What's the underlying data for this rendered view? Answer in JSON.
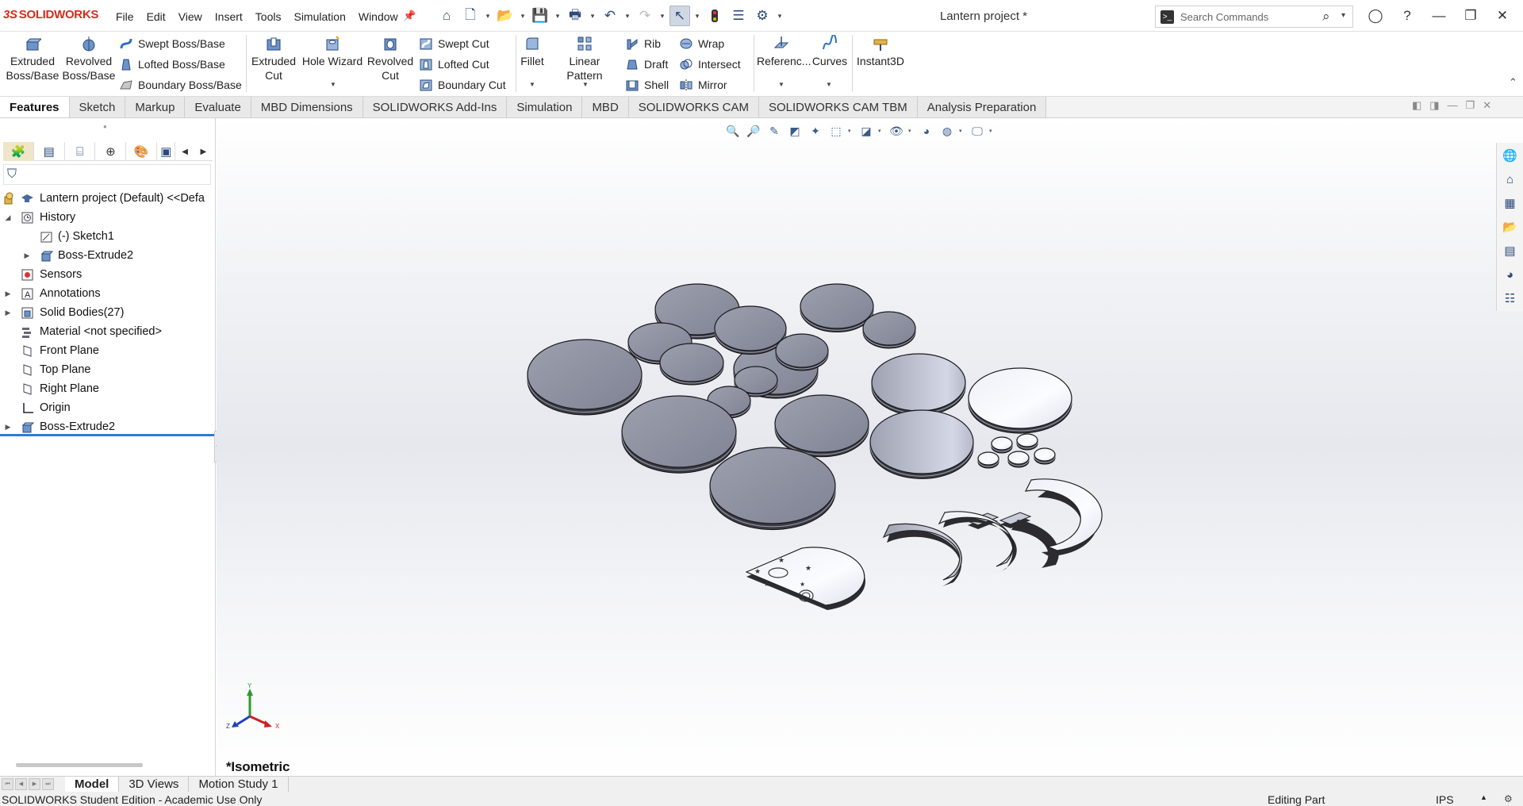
{
  "app": {
    "logo_prefix": "3S",
    "logo_text": "SOLIDWORKS",
    "document_title": "Lantern project *"
  },
  "menus": [
    "File",
    "Edit",
    "View",
    "Insert",
    "Tools",
    "Simulation",
    "Window"
  ],
  "search": {
    "placeholder": "Search Commands"
  },
  "ribbon": {
    "extruded_boss": "Extruded\nBoss/Base",
    "revolved_boss": "Revolved\nBoss/Base",
    "swept_boss": "Swept Boss/Base",
    "lofted_boss": "Lofted Boss/Base",
    "boundary_boss": "Boundary Boss/Base",
    "extruded_cut": "Extruded\nCut",
    "hole_wizard": "Hole Wizard",
    "revolved_cut": "Revolved\nCut",
    "swept_cut": "Swept Cut",
    "lofted_cut": "Lofted Cut",
    "boundary_cut": "Boundary Cut",
    "fillet": "Fillet",
    "linear_pattern": "Linear Pattern",
    "rib": "Rib",
    "draft": "Draft",
    "shell": "Shell",
    "wrap": "Wrap",
    "intersect": "Intersect",
    "mirror": "Mirror",
    "reference": "Referenc...",
    "curves": "Curves",
    "instant3d": "Instant3D"
  },
  "cm_tabs": [
    "Features",
    "Sketch",
    "Markup",
    "Evaluate",
    "MBD Dimensions",
    "SOLIDWORKS Add-Ins",
    "Simulation",
    "MBD",
    "SOLIDWORKS CAM",
    "SOLIDWORKS CAM TBM",
    "Analysis Preparation"
  ],
  "tree": {
    "root": "Lantern project (Default) <<Defa",
    "history": "History",
    "sketch1": "(-) Sketch1",
    "boss_extrude_hist": "Boss-Extrude2",
    "sensors": "Sensors",
    "annotations": "Annotations",
    "solid_bodies": "Solid Bodies(27)",
    "material": "Material <not specified>",
    "front_plane": "Front Plane",
    "top_plane": "Top Plane",
    "right_plane": "Right Plane",
    "origin": "Origin",
    "boss_extrude": "Boss-Extrude2"
  },
  "viewport": {
    "view_name": "*Isometric",
    "triad": {
      "x": "X",
      "y": "Y",
      "z": "Z"
    }
  },
  "bottom_tabs": [
    "Model",
    "3D Views",
    "Motion Study 1"
  ],
  "status": {
    "left": "SOLIDWORKS Student Edition - Academic Use Only",
    "mode": "Editing Part",
    "units": "IPS"
  },
  "colors": {
    "part_gray": "#8f93a3",
    "part_light": "#f2f4fa",
    "accent_blue": "#2e7bd6",
    "logo_red": "#d52b1e"
  }
}
